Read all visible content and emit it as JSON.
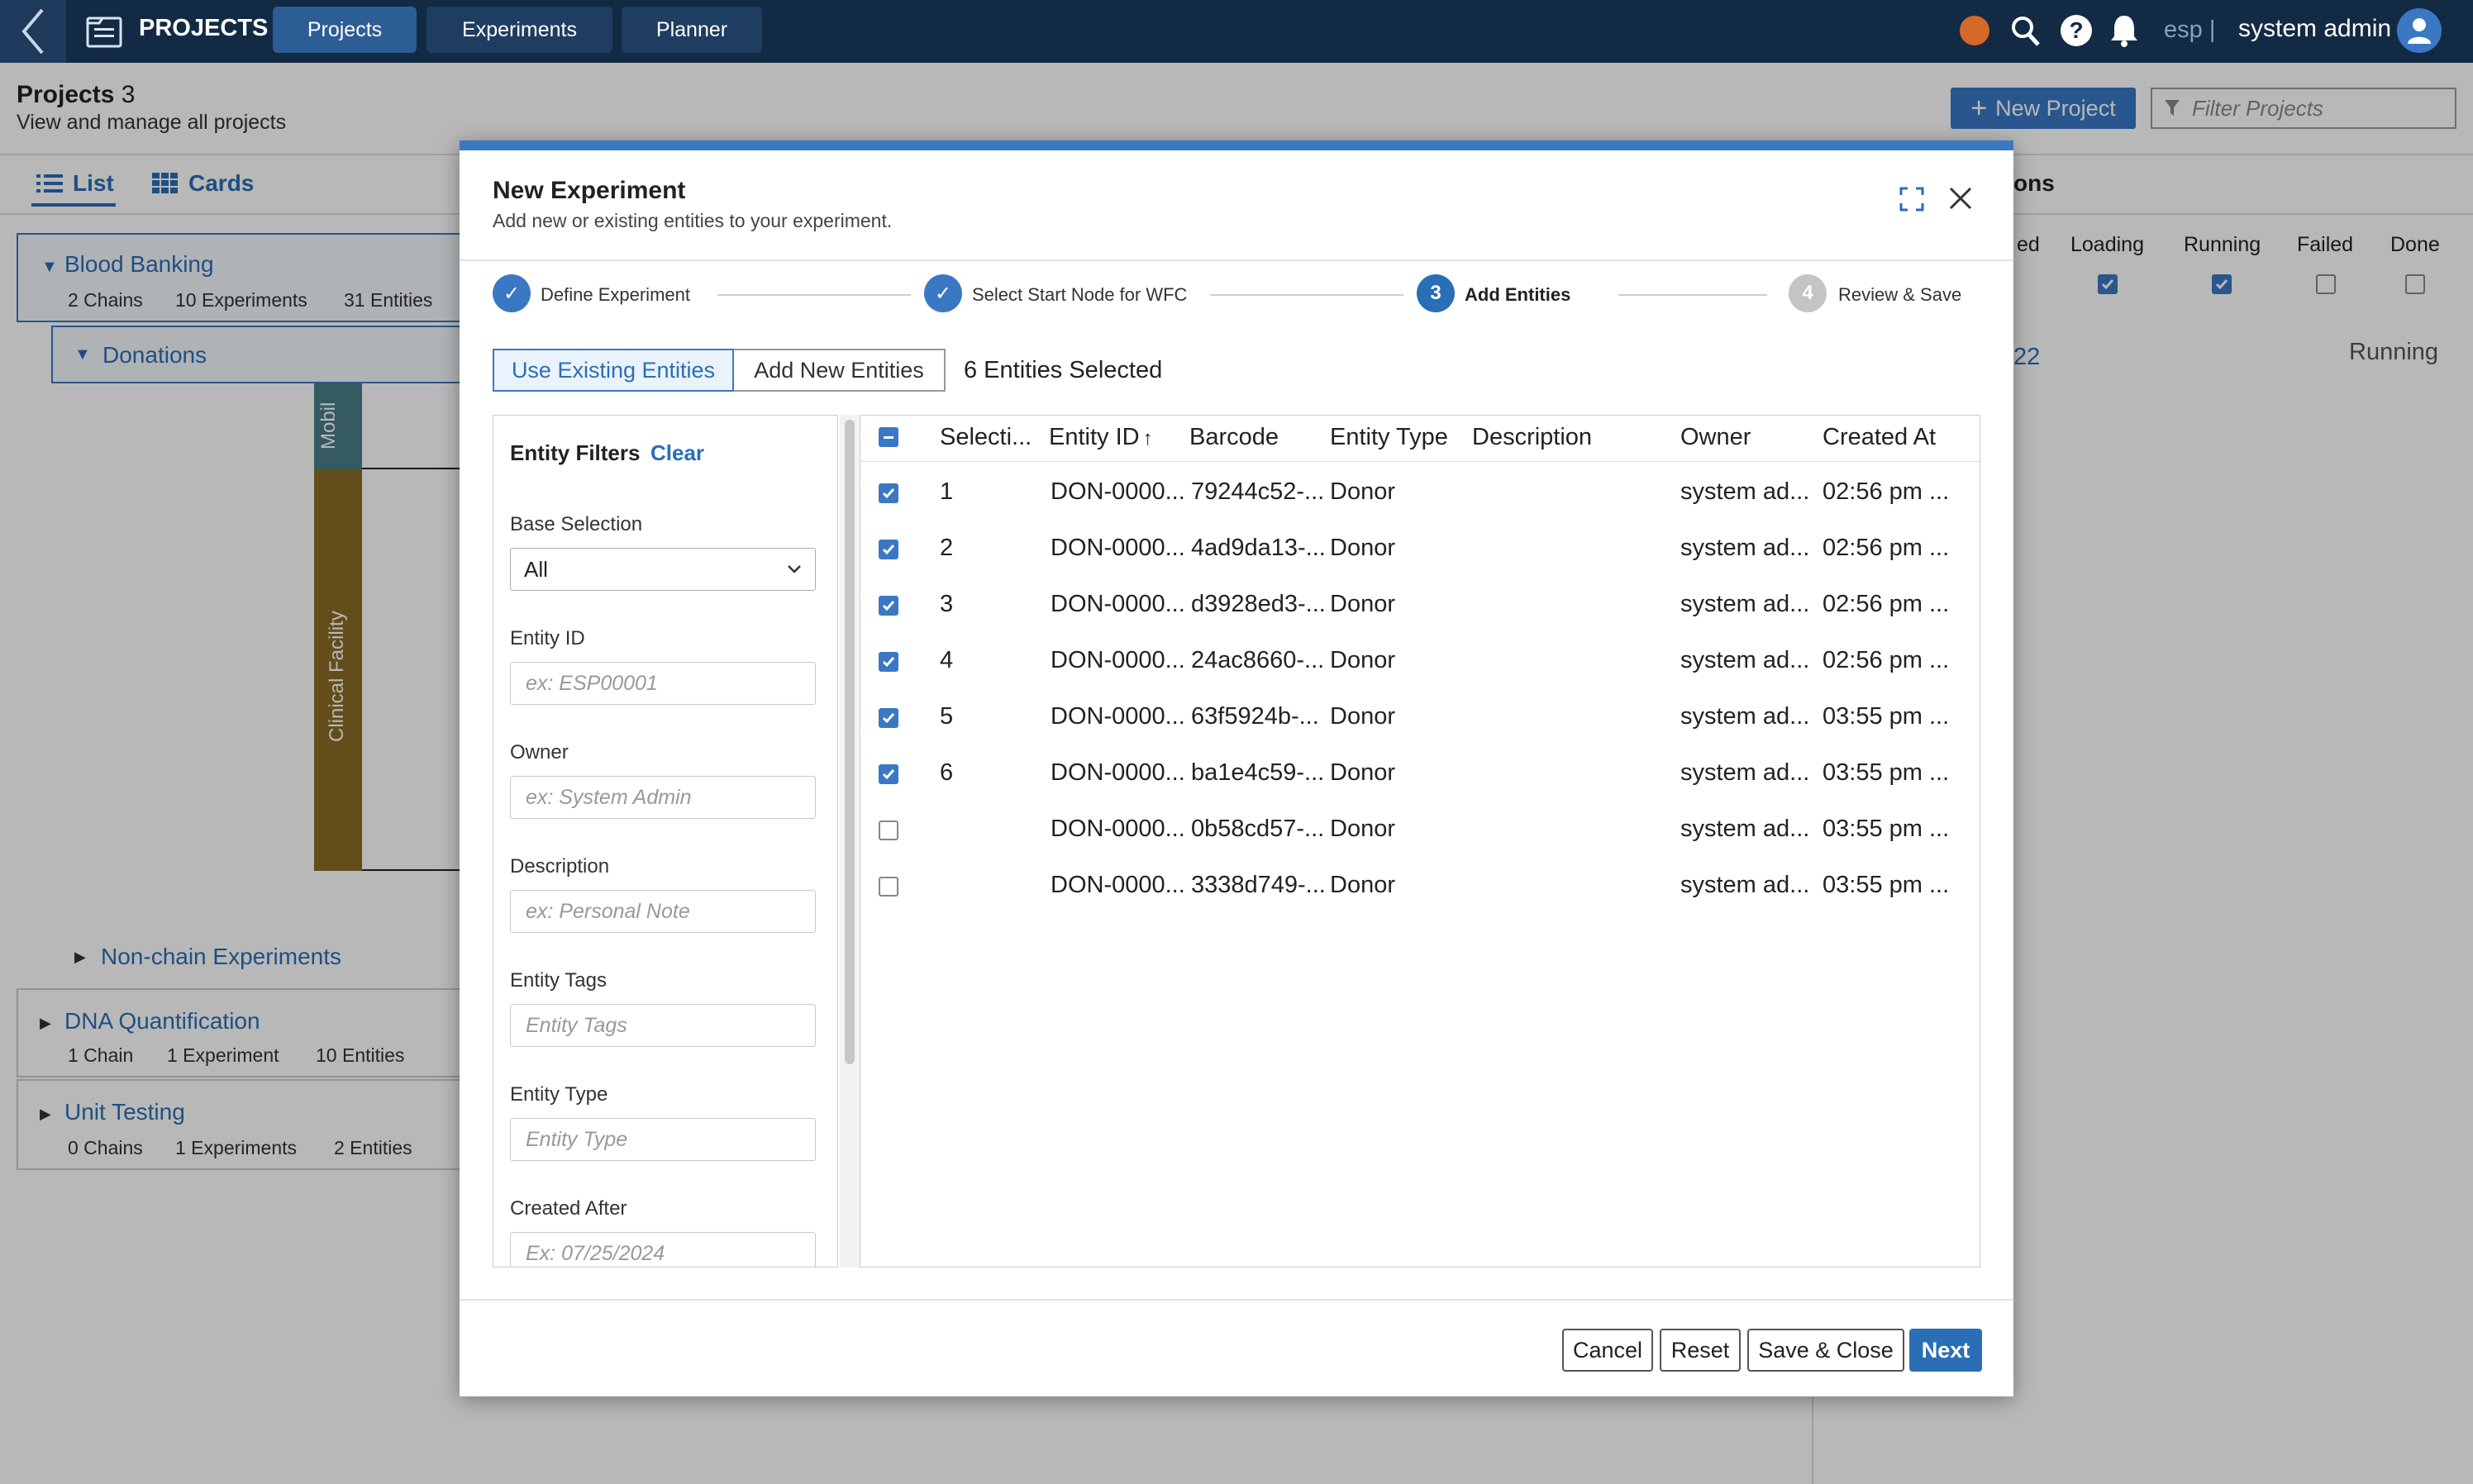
{
  "topbar": {
    "app_title": "PROJECTS",
    "nav": [
      "Projects",
      "Experiments",
      "Planner"
    ],
    "lang": "esp |",
    "user": "system admin"
  },
  "page": {
    "title": "Projects",
    "count": "3",
    "subtitle": "View and manage all projects",
    "new_project": "New Project",
    "filter_placeholder": "Filter Projects",
    "view_tabs": [
      "List",
      "Cards"
    ]
  },
  "projects": [
    {
      "name": "Blood Banking",
      "stats": [
        "2 Chains",
        "10 Experiments",
        "31 Entities"
      ]
    },
    {
      "name": "DNA Quantification",
      "stats": [
        "1 Chain",
        "1 Experiment",
        "10 Entities"
      ]
    },
    {
      "name": "Unit Testing",
      "stats": [
        "0 Chains",
        "1 Experiments",
        "2 Entities"
      ]
    }
  ],
  "chain": {
    "name": "Donations",
    "lane_1": "Mobil",
    "lane_2": "Clinical Facility",
    "non_chain": "Non-chain Experiments"
  },
  "right_panel": {
    "title_fragment": "ons",
    "columns": [
      "ed",
      "Loading",
      "Running",
      "Failed",
      "Done"
    ],
    "checks": [
      true,
      true,
      false,
      false
    ],
    "link_fragment": "22",
    "status": "Running"
  },
  "modal": {
    "title": "New Experiment",
    "subtitle": "Add new or existing entities to your experiment.",
    "steps": [
      {
        "num": "✓",
        "label": "Define Experiment"
      },
      {
        "num": "✓",
        "label": "Select Start Node for WFC"
      },
      {
        "num": "3",
        "label": "Add Entities"
      },
      {
        "num": "4",
        "label": "Review & Save"
      }
    ],
    "tab_existing": "Use Existing Entities",
    "tab_new": "Add New Entities",
    "selected_count": "6 Entities Selected",
    "filters": {
      "title": "Entity Filters",
      "clear": "Clear",
      "base_selection_label": "Base Selection",
      "base_selection_value": "All",
      "entity_id_label": "Entity ID",
      "entity_id_placeholder": "ex: ESP00001",
      "owner_label": "Owner",
      "owner_placeholder": "ex: System Admin",
      "description_label": "Description",
      "description_placeholder": "ex: Personal Note",
      "tags_label": "Entity Tags",
      "tags_placeholder": "Entity Tags",
      "type_label": "Entity Type",
      "type_placeholder": "Entity Type",
      "created_after_label": "Created After",
      "created_after_placeholder": "Ex: 07/25/2024"
    },
    "table": {
      "headers": [
        "Selecti...",
        "Entity ID",
        "Barcode",
        "Entity Type",
        "Description",
        "Owner",
        "Created At"
      ],
      "rows": [
        {
          "checked": true,
          "sel": "1",
          "id": "DON-0000...",
          "barcode": "79244c52-...",
          "type": "Donor",
          "desc": "",
          "owner": "system ad...",
          "created": "02:56 pm ..."
        },
        {
          "checked": true,
          "sel": "2",
          "id": "DON-0000...",
          "barcode": "4ad9da13-...",
          "type": "Donor",
          "desc": "",
          "owner": "system ad...",
          "created": "02:56 pm ..."
        },
        {
          "checked": true,
          "sel": "3",
          "id": "DON-0000...",
          "barcode": "d3928ed3-...",
          "type": "Donor",
          "desc": "",
          "owner": "system ad...",
          "created": "02:56 pm ..."
        },
        {
          "checked": true,
          "sel": "4",
          "id": "DON-0000...",
          "barcode": "24ac8660-...",
          "type": "Donor",
          "desc": "",
          "owner": "system ad...",
          "created": "02:56 pm ..."
        },
        {
          "checked": true,
          "sel": "5",
          "id": "DON-0000...",
          "barcode": "63f5924b-...",
          "type": "Donor",
          "desc": "",
          "owner": "system ad...",
          "created": "03:55 pm ..."
        },
        {
          "checked": true,
          "sel": "6",
          "id": "DON-0000...",
          "barcode": "ba1e4c59-...",
          "type": "Donor",
          "desc": "",
          "owner": "system ad...",
          "created": "03:55 pm ..."
        },
        {
          "checked": false,
          "sel": "",
          "id": "DON-0000...",
          "barcode": "0b58cd57-...",
          "type": "Donor",
          "desc": "",
          "owner": "system ad...",
          "created": "03:55 pm ..."
        },
        {
          "checked": false,
          "sel": "",
          "id": "DON-0000...",
          "barcode": "3338d749-...",
          "type": "Donor",
          "desc": "",
          "owner": "system ad...",
          "created": "03:55 pm ..."
        }
      ]
    },
    "footer": {
      "cancel": "Cancel",
      "reset": "Reset",
      "save_close": "Save & Close",
      "next": "Next"
    }
  },
  "colors": {
    "topbar": "#132a45",
    "accent": "#3a78c4",
    "link": "#2a6eb5",
    "lane_teal": "#4a7d87",
    "lane_gold": "#8a6d26",
    "status_dot": "#d4692a"
  }
}
